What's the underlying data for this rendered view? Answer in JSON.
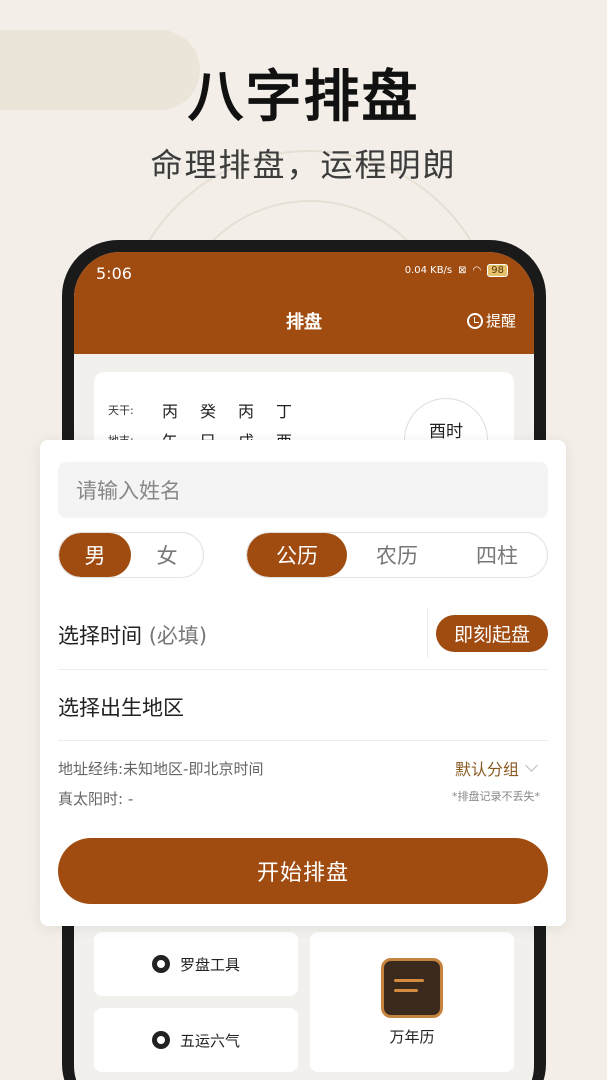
{
  "hero": {
    "title": "八字排盘",
    "subtitle": "命理排盘，运程明朗"
  },
  "status_bar": {
    "time": "5:06",
    "net_speed": "0.04 KB/s",
    "battery": "98"
  },
  "app_header": {
    "title": "排盘",
    "remind_label": "提醒"
  },
  "preview": {
    "stems_label": "天干:",
    "stems": [
      "丙",
      "癸",
      "丙",
      "丁"
    ],
    "branches_label": "地支:",
    "branches": [
      "午",
      "巳",
      "戌",
      "酉"
    ],
    "hour_label": "酉时"
  },
  "form": {
    "name_placeholder": "请输入姓名",
    "gender": {
      "options": [
        "男",
        "女"
      ],
      "selected": "男"
    },
    "calendar": {
      "options": [
        "公历",
        "农历",
        "四柱"
      ],
      "selected": "公历"
    },
    "time_label": "选择时间",
    "time_hint": "(必填)",
    "now_button": "即刻起盘",
    "region_label": "选择出生地区",
    "address_info": "地址经纬:未知地区-即北京时间",
    "solar_time": "真太阳时: -",
    "group_label": "默认分组",
    "note": "*排盘记录不丢失*",
    "start_button": "开始排盘"
  },
  "tools": {
    "compass": "罗盘工具",
    "wuyun": "五运六气",
    "calendar": "万年历"
  },
  "colors": {
    "accent": "#a04c11",
    "background": "#f3efe8"
  }
}
